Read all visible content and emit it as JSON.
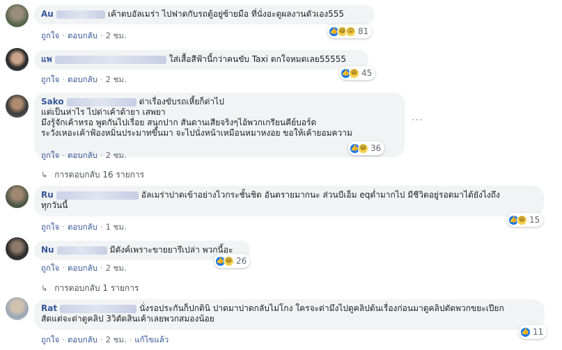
{
  "comments": [
    {
      "author": "Au",
      "text": "เค้าตบอัลเมร่า ไปฟาดกับรถตู้อยู่ซ้ายมือ ที่นั่งอะดูผลงานตัวเอง555",
      "like": "ถูกใจ",
      "reply": "ตอบกลับ",
      "time": "2 ชม.",
      "reaction_count": "81",
      "reactions": [
        "like",
        "haha",
        "wow"
      ]
    },
    {
      "author": "แพ",
      "text": "ใส่เสื้อสีฟ้านี้กว่าคนขับ Taxi ตกใจหมดเลย55555",
      "like": "ถูกใจ",
      "reply": "ตอบกลับ",
      "time": "2 ชม.",
      "reaction_count": "45",
      "reactions": [
        "like",
        "haha"
      ]
    },
    {
      "author": "Sako",
      "lines": [
        "ด่าเรื่องขับรถเหี้ยก็ด่าไป",
        "แต่เป็นห่าไร ไปด่าเค้าด้ายา เสพยา",
        "มึงรู้จักเค้าหรอ พูดกันไปเรื่อย สนุกปาก สันดานเสียจริงๆไอ้พวกเกรียนคีย์บอร์ด",
        "ระวังเหอะเค้าฟ้องหมิ่นประมาทขึ้นมา จะไปนั่งหน้าเหมือนหมาหงอย ขอให้เค้ายอมความ"
      ],
      "like": "ถูกใจ",
      "reply": "ตอบกลับ",
      "time": "2 ชม.",
      "reaction_count": "36",
      "reactions": [
        "like",
        "haha"
      ],
      "replies_label": "การตอบกลับ 16 รายการ"
    },
    {
      "author": "Ru",
      "lines": [
        "อัลเมร่าปาดเข้าอย่างไวกระชั้นชิด อันตรายมากนะ ส่วนบีเอ็ม eqต่ำมากไป มีชีวิตอยู่รอดมาได้ยังไงถึง",
        "ทุกวันนี้"
      ],
      "like": "ถูกใจ",
      "reply": "ตอบกลับ",
      "time": "1 ชม.",
      "reaction_count": "15",
      "reactions": [
        "like",
        "haha"
      ]
    },
    {
      "author": "Nu",
      "text": "มีตังค์เพราะขายยารึเปล่า พวกนี้อะ",
      "like": "ถูกใจ",
      "reply": "ตอบกลับ",
      "time": "2 ชม.",
      "reaction_count": "26",
      "reactions": [
        "like",
        "haha"
      ],
      "replies_label": "การตอบกลับ 1 รายการ"
    },
    {
      "author": "Rat",
      "lines": [
        "นั่งรอประกันก็ปกตินิ ปาดมาปาดกลับไม่โกง ใครจะด่ามึงไปดูคลิปต้นเรื่องก่อนมาดูคลิปตัดพวกขยะเปียก",
        "สัดแต่จะด่าดูคลิป 3วิตัดสินเค้าเลยพวกสมองน้อย"
      ],
      "like": "ถูกใจ",
      "reply": "ตอบกลับ",
      "time": "2 ชม.",
      "edited": "แก้ไขแล้ว",
      "reaction_count": "11",
      "reactions": [
        "like"
      ]
    }
  ],
  "more_icon": "ellipsis-icon",
  "colors": {
    "link": "#385898",
    "bubble": "#f2f3f5",
    "like": "#1877f2",
    "haha": "#f7d04e"
  }
}
